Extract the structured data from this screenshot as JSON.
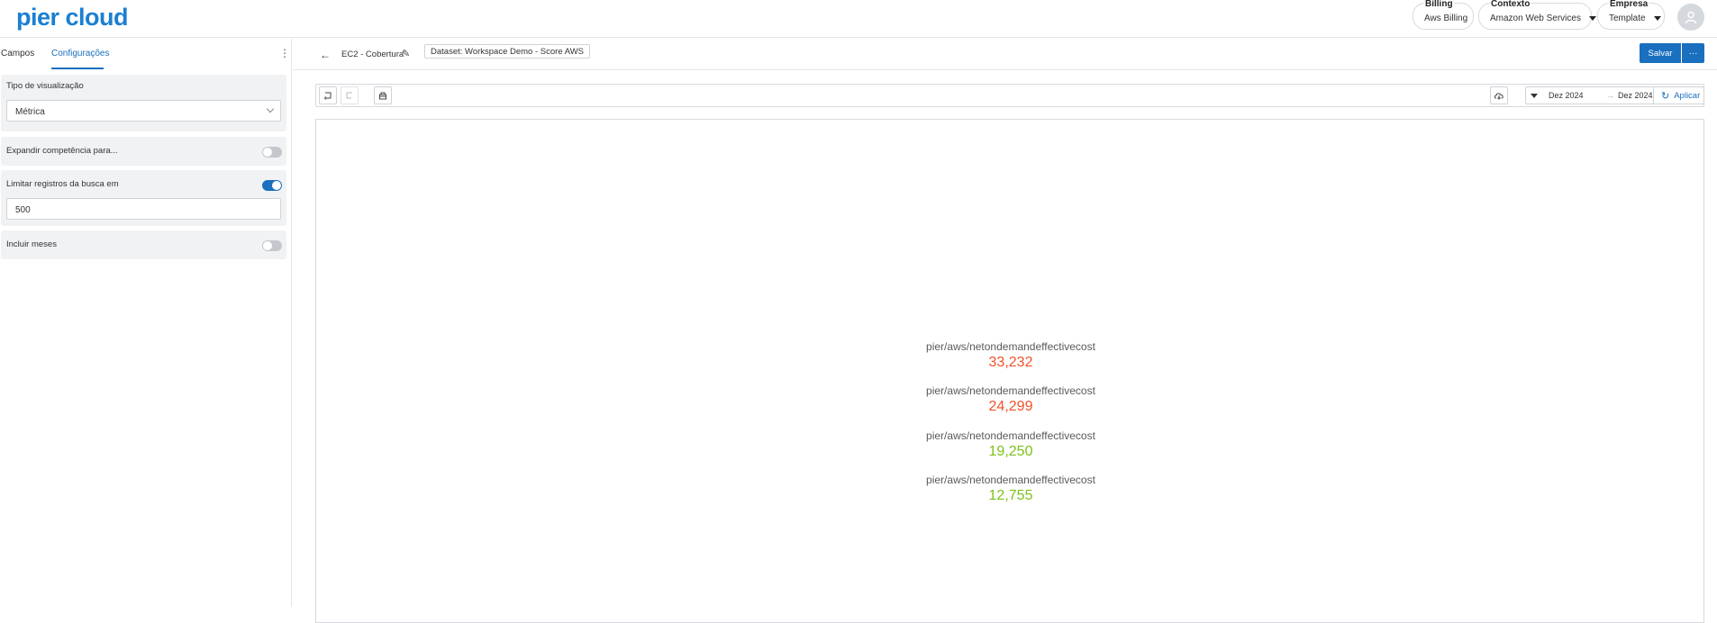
{
  "app": {
    "logo_text": "pier cloud"
  },
  "header": {
    "billing": {
      "label": "Billing",
      "value": "Aws Billing"
    },
    "contexto": {
      "label": "Contexto",
      "value": "Amazon Web Services"
    },
    "empresa": {
      "label": "Empresa",
      "value": "Template"
    }
  },
  "left_panel": {
    "tabs": [
      {
        "label": "Campos",
        "active": false
      },
      {
        "label": "Configurações",
        "active": true
      }
    ],
    "visualization": {
      "label": "Tipo de visualização",
      "value": "Métrica"
    },
    "expand": {
      "label": "Expandir competência para...",
      "enabled": false
    },
    "limit": {
      "label": "Limitar registros da busca em",
      "enabled": true,
      "value": "500"
    },
    "include_months": {
      "label": "Incluir meses",
      "enabled": false
    }
  },
  "main": {
    "title": "EC2 - Cobertura",
    "dataset": "Dataset: Workspace Demo - Score AWS",
    "save_label": "Salvar",
    "more_label": "···",
    "date_from": "Dez 2024",
    "date_arrow": "→",
    "date_to": "Dez 2024",
    "apply_label": "Aplicar"
  },
  "metrics": [
    {
      "label": "pier/aws/netondemandeffectivecost",
      "value": "33,232",
      "color": "#f0522a"
    },
    {
      "label": "pier/aws/netondemandeffectivecost",
      "value": "24,299",
      "color": "#f0522a"
    },
    {
      "label": "pier/aws/netondemandeffectivecost",
      "value": "19,250",
      "color": "#7cc21a"
    },
    {
      "label": "pier/aws/netondemandeffectivecost",
      "value": "12,755",
      "color": "#7cc21a"
    }
  ],
  "colors": {
    "accent": "#1a6fbf",
    "brand": "#1a7fd1"
  }
}
